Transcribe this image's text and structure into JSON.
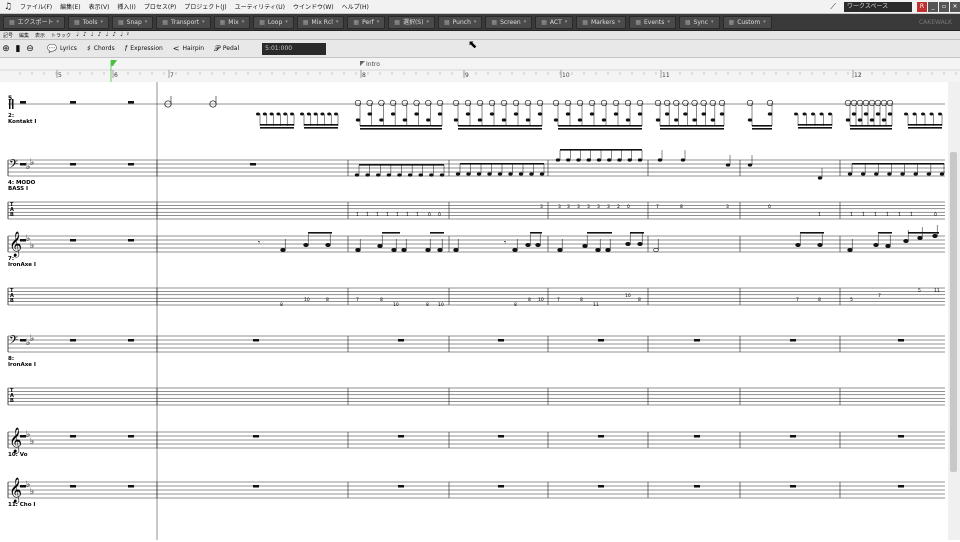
{
  "menu": {
    "items": [
      "ファイル(F)",
      "編集(E)",
      "表示(V)",
      "挿入(I)",
      "プロセス(P)",
      "プロジェクト(J)",
      "ユーティリティ(U)",
      "ウインドウ(W)",
      "ヘルプ(H)"
    ],
    "workspace": "ワークスペース",
    "window_buttons": [
      "R",
      "_",
      "▫",
      "✕"
    ]
  },
  "modules": [
    "エクスポート",
    "Tools",
    "Snap",
    "Transport",
    "Mix",
    "Loop",
    "Mix Rcl",
    "Perf",
    "選択(S)",
    "Punch",
    "Screen",
    "ACT",
    "Markers",
    "Events",
    "Sync",
    "Custom"
  ],
  "view_menu": {
    "items": [
      "記号",
      "編集",
      "表示",
      "トラック"
    ],
    "notes": [
      "♩",
      "♪",
      "♩",
      "♪",
      "♩",
      "♪",
      "♩",
      "𝄽"
    ]
  },
  "toolbar": {
    "tools": [
      {
        "icon": "lyrics-icon",
        "label": "Lyrics"
      },
      {
        "icon": "chords-icon",
        "label": "Chords"
      },
      {
        "icon": "expression-icon",
        "label": "Expression"
      },
      {
        "icon": "hairpin-icon",
        "label": "Hairpin"
      },
      {
        "icon": "pedal-icon",
        "label": "Pedal"
      }
    ],
    "time": "5:01:000"
  },
  "timeline": {
    "measures": [
      "5",
      "6",
      "7",
      "8",
      "9",
      "10",
      "11",
      "12"
    ],
    "marker": "Intro"
  },
  "score": {
    "top_measure": "5",
    "tracks": [
      {
        "label": "2:\nKontakt I",
        "clef": "perc"
      },
      {
        "label": "4: MODO\nBASS I",
        "clef": "bass"
      },
      {
        "label": "",
        "clef": "tab"
      },
      {
        "label": "7:\nIronAxe I",
        "clef": "treble"
      },
      {
        "label": "",
        "clef": "tab"
      },
      {
        "label": "8:\nIronAxe I",
        "clef": "bass"
      },
      {
        "label": "",
        "clef": "tab"
      },
      {
        "label": "10: Vo",
        "clef": "treble"
      },
      {
        "label": "11: Cho I",
        "clef": "treble"
      }
    ],
    "bass_tab_numbers": [
      "1",
      "1",
      "1",
      "1",
      "1",
      "1",
      "1",
      "0",
      "0",
      "3",
      "3",
      "3",
      "3",
      "3",
      "3",
      "3",
      "2",
      "0",
      "7",
      "8",
      "3",
      "0",
      "1",
      "1",
      "1",
      "1",
      "1",
      "1",
      "1",
      "0"
    ],
    "guitar_tab_numbers": [
      "8",
      "10",
      "8",
      "7",
      "8",
      "10",
      "8",
      "10",
      "8",
      "10",
      "8",
      "7",
      "8",
      "11",
      "10",
      "8",
      "7",
      "8",
      "5",
      "7",
      "5",
      "11"
    ]
  }
}
